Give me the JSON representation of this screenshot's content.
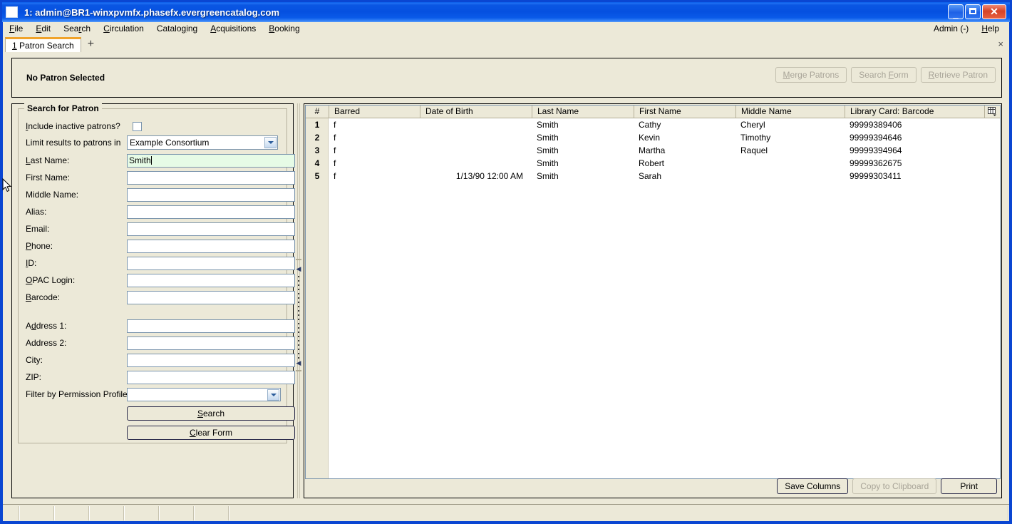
{
  "window": {
    "title": "1: admin@BR1-winxpvmfx.phasefx.evergreencatalog.com",
    "minimize_label": "_",
    "maximize_label": "",
    "close_label": "✕"
  },
  "menubar": {
    "items": [
      {
        "label": "File",
        "accel": "F"
      },
      {
        "label": "Edit",
        "accel": "E"
      },
      {
        "label": "Search",
        "accel": "r"
      },
      {
        "label": "Circulation",
        "accel": "C"
      },
      {
        "label": "Cataloging",
        "accel": "g"
      },
      {
        "label": "Acquisitions",
        "accel": "A"
      },
      {
        "label": "Booking",
        "accel": "B"
      }
    ],
    "right_items": [
      {
        "label": "Admin (-)"
      },
      {
        "label": "Help"
      }
    ]
  },
  "tabs": {
    "items": [
      {
        "label": "1 Patron Search"
      }
    ],
    "add_label": "+",
    "close_label": "×"
  },
  "patron_header": {
    "title": "No Patron Selected",
    "buttons": [
      {
        "label": "Merge Patrons",
        "disabled": true
      },
      {
        "label": "Search Form",
        "disabled": true
      },
      {
        "label": "Retrieve Patron",
        "disabled": true
      }
    ]
  },
  "search_form": {
    "legend": "Search for Patron",
    "fields": [
      {
        "label": "Include inactive patrons?",
        "type": "checkbox",
        "value": "",
        "checked": false
      },
      {
        "label": "Limit results to patrons in",
        "type": "select",
        "value": "Example Consortium"
      },
      {
        "label": "Last Name:",
        "type": "text",
        "value": "Smith",
        "focused": true
      },
      {
        "label": "First Name:",
        "type": "text",
        "value": ""
      },
      {
        "label": "Middle Name:",
        "type": "text",
        "value": ""
      },
      {
        "label": "Alias:",
        "type": "text",
        "value": ""
      },
      {
        "label": "Email:",
        "type": "text",
        "value": ""
      },
      {
        "label": "Phone:",
        "type": "text",
        "value": ""
      },
      {
        "label": "ID:",
        "type": "text",
        "value": ""
      },
      {
        "label": "OPAC Login:",
        "type": "text",
        "value": ""
      },
      {
        "label": "Barcode:",
        "type": "text",
        "value": ""
      },
      {
        "label": "Address 1:",
        "type": "text",
        "value": ""
      },
      {
        "label": "Address 2:",
        "type": "text",
        "value": ""
      },
      {
        "label": "City:",
        "type": "text",
        "value": ""
      },
      {
        "label": "ZIP:",
        "type": "text",
        "value": ""
      },
      {
        "label": "Filter by Permission Profile:",
        "type": "select",
        "value": ""
      }
    ],
    "search_button": "Search",
    "clear_button": "Clear Form"
  },
  "results": {
    "columns": [
      "#",
      "Barred",
      "Date of Birth",
      "Last Name",
      "First Name",
      "Middle Name",
      "Library Card: Barcode"
    ],
    "column_picker_icon": "column-picker-icon",
    "rows": [
      {
        "num": "1",
        "barred": "f",
        "dob": "",
        "last": "Smith",
        "first": "Cathy",
        "middle": "Cheryl",
        "barcode": "99999389406"
      },
      {
        "num": "2",
        "barred": "f",
        "dob": "",
        "last": "Smith",
        "first": "Kevin",
        "middle": "Timothy",
        "barcode": "99999394646"
      },
      {
        "num": "3",
        "barred": "f",
        "dob": "",
        "last": "Smith",
        "first": "Martha",
        "middle": "Raquel",
        "barcode": "99999394964"
      },
      {
        "num": "4",
        "barred": "f",
        "dob": "",
        "last": "Smith",
        "first": "Robert",
        "middle": "",
        "barcode": "99999362675"
      },
      {
        "num": "5",
        "barred": "f",
        "dob": "1/13/90 12:00 AM",
        "last": "Smith",
        "first": "Sarah",
        "middle": "",
        "barcode": "99999303411"
      }
    ],
    "buttons": [
      {
        "label": "Save Columns",
        "disabled": false
      },
      {
        "label": "Copy to Clipboard",
        "disabled": true
      },
      {
        "label": "Print",
        "disabled": false
      }
    ]
  },
  "colors": {
    "titlebar_blue": "#0550e0",
    "window_border": "#0a46d2",
    "face": "#ece9d8",
    "tab_accent": "#f0a32a",
    "field_border": "#7b95ad",
    "focused_field_bg": "#e6fbe6"
  }
}
